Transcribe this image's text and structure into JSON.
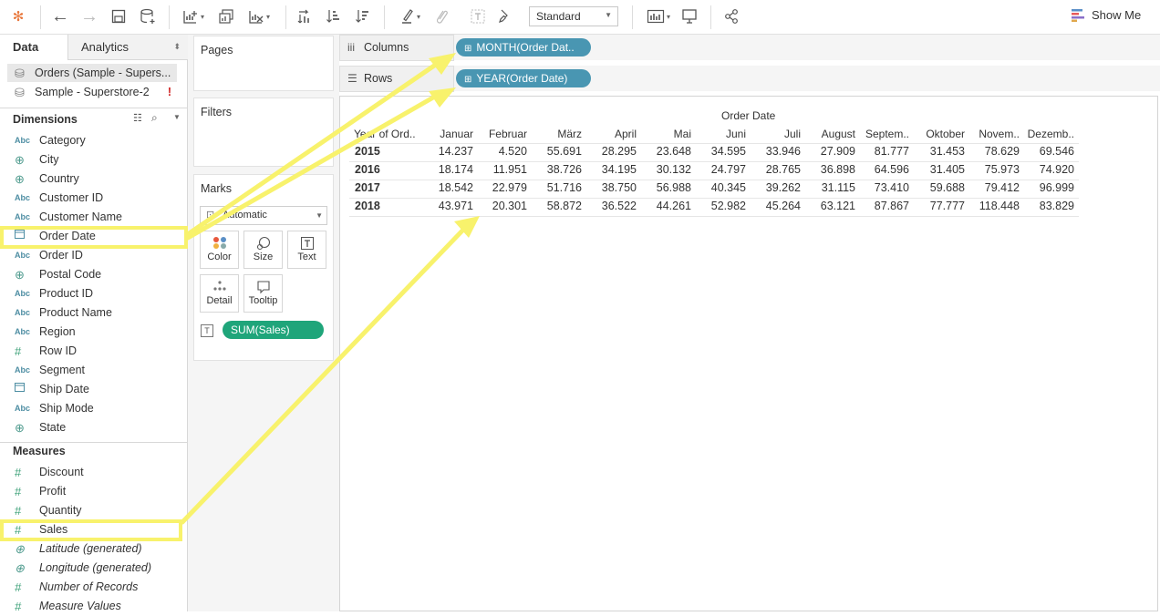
{
  "toolbar": {
    "standard_select": "Standard",
    "show_me": "Show Me"
  },
  "data_pane": {
    "tab_data": "Data",
    "tab_analytics": "Analytics",
    "datasources": [
      "Orders (Sample - Supers...",
      "Sample - Superstore-2"
    ],
    "dimensions_header": "Dimensions",
    "dimensions": [
      {
        "type": "Abc",
        "name": "Category"
      },
      {
        "type": "geo",
        "name": "City"
      },
      {
        "type": "geo",
        "name": "Country"
      },
      {
        "type": "Abc",
        "name": "Customer ID"
      },
      {
        "type": "Abc",
        "name": "Customer Name"
      },
      {
        "type": "date",
        "name": "Order Date"
      },
      {
        "type": "Abc",
        "name": "Order ID"
      },
      {
        "type": "geo",
        "name": "Postal Code"
      },
      {
        "type": "Abc",
        "name": "Product ID"
      },
      {
        "type": "Abc",
        "name": "Product Name"
      },
      {
        "type": "Abc",
        "name": "Region"
      },
      {
        "type": "num",
        "name": "Row ID"
      },
      {
        "type": "Abc",
        "name": "Segment"
      },
      {
        "type": "date",
        "name": "Ship Date"
      },
      {
        "type": "Abc",
        "name": "Ship Mode"
      },
      {
        "type": "geo",
        "name": "State"
      }
    ],
    "measures_header": "Measures",
    "measures": [
      {
        "type": "num",
        "name": "Discount",
        "italic": false
      },
      {
        "type": "num",
        "name": "Profit",
        "italic": false
      },
      {
        "type": "num",
        "name": "Quantity",
        "italic": false
      },
      {
        "type": "num",
        "name": "Sales",
        "italic": false
      },
      {
        "type": "geo",
        "name": "Latitude (generated)",
        "italic": true
      },
      {
        "type": "geo",
        "name": "Longitude (generated)",
        "italic": true
      },
      {
        "type": "num",
        "name": "Number of Records",
        "italic": true
      },
      {
        "type": "num",
        "name": "Measure Values",
        "italic": true
      }
    ]
  },
  "cards": {
    "pages": "Pages",
    "filters": "Filters",
    "marks": "Marks",
    "mark_type": "Automatic",
    "color": "Color",
    "size": "Size",
    "text": "Text",
    "detail": "Detail",
    "tooltip": "Tooltip",
    "sum_sales": "SUM(Sales)"
  },
  "shelves": {
    "columns_label": "Columns",
    "columns_pill": "MONTH(Order Dat..",
    "rows_label": "Rows",
    "rows_pill": "YEAR(Order Date)"
  },
  "table": {
    "title": "Order Date",
    "row_header": "Year of Ord..",
    "months": [
      "Januar",
      "Februar",
      "März",
      "April",
      "Mai",
      "Juni",
      "Juli",
      "August",
      "Septem..",
      "Oktober",
      "Novem..",
      "Dezemb.."
    ],
    "rows": [
      {
        "year": "2015",
        "values": [
          "14.237",
          "4.520",
          "55.691",
          "28.295",
          "23.648",
          "34.595",
          "33.946",
          "27.909",
          "81.777",
          "31.453",
          "78.629",
          "69.546"
        ]
      },
      {
        "year": "2016",
        "values": [
          "18.174",
          "11.951",
          "38.726",
          "34.195",
          "30.132",
          "24.797",
          "28.765",
          "36.898",
          "64.596",
          "31.405",
          "75.973",
          "74.920"
        ]
      },
      {
        "year": "2017",
        "values": [
          "18.542",
          "22.979",
          "51.716",
          "38.750",
          "56.988",
          "40.345",
          "39.262",
          "31.115",
          "73.410",
          "59.688",
          "79.412",
          "96.999"
        ]
      },
      {
        "year": "2018",
        "values": [
          "43.971",
          "20.301",
          "58.872",
          "36.522",
          "44.261",
          "52.982",
          "45.264",
          "63.121",
          "87.867",
          "77.777",
          "118.448",
          "83.829"
        ]
      }
    ]
  },
  "colors": {
    "pill_blue": "#4996b2",
    "pill_green": "#1fa57a",
    "highlight": "#f8f26c"
  }
}
